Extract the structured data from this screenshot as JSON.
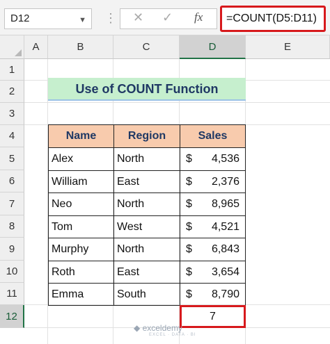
{
  "formula_bar": {
    "name_box": "D12",
    "formula": "=COUNT(D5:D11)",
    "dots": "⋮",
    "fx_label": "fx"
  },
  "columns": [
    "A",
    "B",
    "C",
    "D",
    "E"
  ],
  "rows": [
    "1",
    "2",
    "3",
    "4",
    "5",
    "6",
    "7",
    "8",
    "9",
    "10",
    "11",
    "12"
  ],
  "title": "Use of COUNT Function",
  "table": {
    "headers": [
      "Name",
      "Region",
      "Sales"
    ],
    "rows": [
      {
        "name": "Alex",
        "region": "North",
        "currency": "$",
        "sales": "4,536"
      },
      {
        "name": "William",
        "region": "East",
        "currency": "$",
        "sales": "2,376"
      },
      {
        "name": "Neo",
        "region": "North",
        "currency": "$",
        "sales": "8,965"
      },
      {
        "name": "Tom",
        "region": "West",
        "currency": "$",
        "sales": "4,521"
      },
      {
        "name": "Murphy",
        "region": "North",
        "currency": "$",
        "sales": "6,843"
      },
      {
        "name": "Roth",
        "region": "East",
        "currency": "$",
        "sales": "3,654"
      },
      {
        "name": "Emma",
        "region": "South",
        "currency": "$",
        "sales": "8,790"
      }
    ]
  },
  "result": "7",
  "watermark": {
    "name": "exceldemy",
    "tagline": "EXCEL · DATA · BI"
  },
  "colors": {
    "title_fill": "#c6efce",
    "header_fill": "#f8cbad",
    "highlight": "#d7191c"
  }
}
